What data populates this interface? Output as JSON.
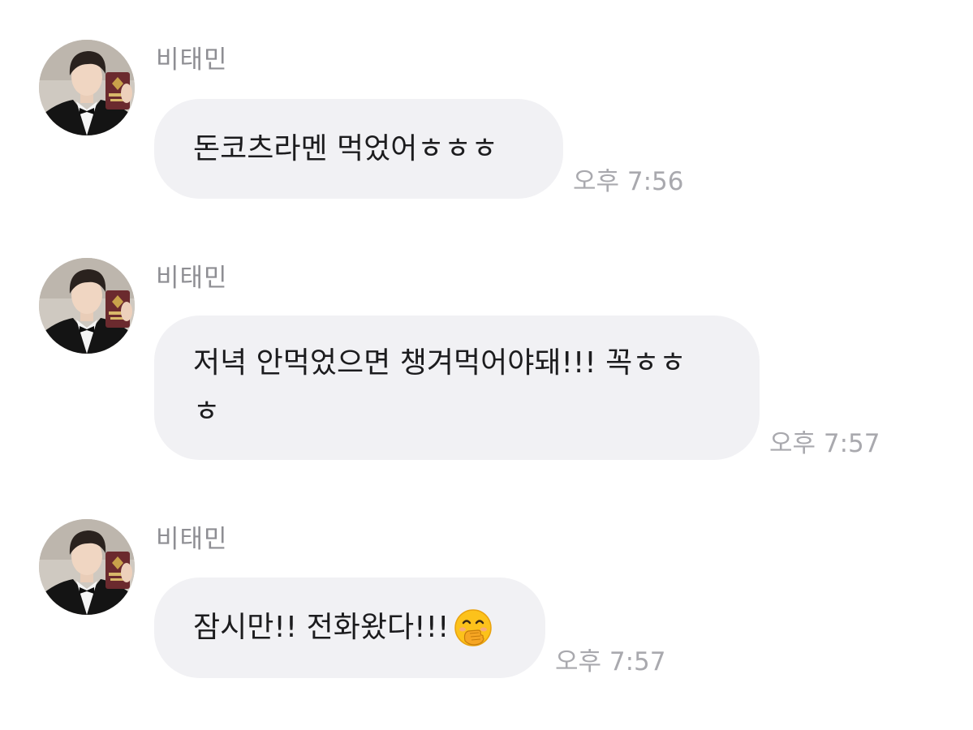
{
  "messages": [
    {
      "sender": "비태민",
      "avatar": "profile-photo-icon",
      "text": "돈코츠라멘 먹었어ㅎㅎㅎ",
      "time": "오후 7:56"
    },
    {
      "sender": "비태민",
      "avatar": "profile-photo-icon",
      "text": "저녁 안먹었으면 챙겨먹어야돼!!! 꼭ㅎㅎ\nㅎ",
      "time": "오후 7:57"
    },
    {
      "sender": "비태민",
      "avatar": "profile-photo-icon",
      "text": "잠시만!! 전화왔다!!!",
      "emoji": "face-with-hand-over-mouth-icon",
      "time": "오후 7:57"
    }
  ],
  "colors": {
    "background": "#ffffff",
    "bubble": "#f1f1f4",
    "message_text": "#1c1c1e",
    "sender_text": "#8e8e93",
    "time_text": "#a9a9ae"
  }
}
